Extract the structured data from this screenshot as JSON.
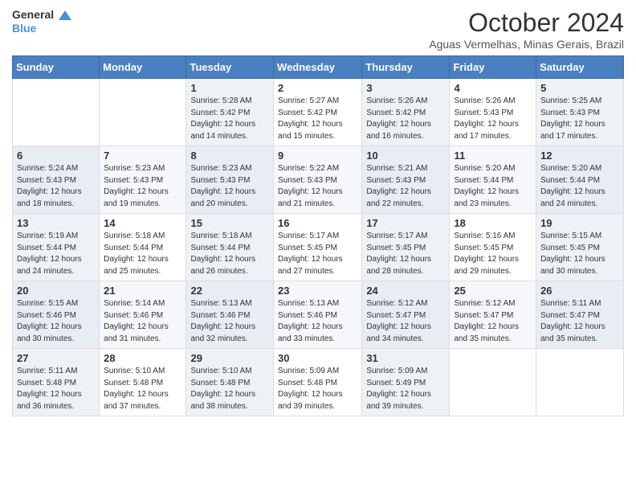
{
  "header": {
    "logo_line1": "General",
    "logo_line2": "Blue",
    "month_title": "October 2024",
    "location": "Aguas Vermelhas, Minas Gerais, Brazil"
  },
  "days_of_week": [
    "Sunday",
    "Monday",
    "Tuesday",
    "Wednesday",
    "Thursday",
    "Friday",
    "Saturday"
  ],
  "weeks": [
    [
      {
        "day": "",
        "info": ""
      },
      {
        "day": "",
        "info": ""
      },
      {
        "day": "1",
        "info": "Sunrise: 5:28 AM\nSunset: 5:42 PM\nDaylight: 12 hours and 14 minutes."
      },
      {
        "day": "2",
        "info": "Sunrise: 5:27 AM\nSunset: 5:42 PM\nDaylight: 12 hours and 15 minutes."
      },
      {
        "day": "3",
        "info": "Sunrise: 5:26 AM\nSunset: 5:42 PM\nDaylight: 12 hours and 16 minutes."
      },
      {
        "day": "4",
        "info": "Sunrise: 5:26 AM\nSunset: 5:43 PM\nDaylight: 12 hours and 17 minutes."
      },
      {
        "day": "5",
        "info": "Sunrise: 5:25 AM\nSunset: 5:43 PM\nDaylight: 12 hours and 17 minutes."
      }
    ],
    [
      {
        "day": "6",
        "info": "Sunrise: 5:24 AM\nSunset: 5:43 PM\nDaylight: 12 hours and 18 minutes."
      },
      {
        "day": "7",
        "info": "Sunrise: 5:23 AM\nSunset: 5:43 PM\nDaylight: 12 hours and 19 minutes."
      },
      {
        "day": "8",
        "info": "Sunrise: 5:23 AM\nSunset: 5:43 PM\nDaylight: 12 hours and 20 minutes."
      },
      {
        "day": "9",
        "info": "Sunrise: 5:22 AM\nSunset: 5:43 PM\nDaylight: 12 hours and 21 minutes."
      },
      {
        "day": "10",
        "info": "Sunrise: 5:21 AM\nSunset: 5:43 PM\nDaylight: 12 hours and 22 minutes."
      },
      {
        "day": "11",
        "info": "Sunrise: 5:20 AM\nSunset: 5:44 PM\nDaylight: 12 hours and 23 minutes."
      },
      {
        "day": "12",
        "info": "Sunrise: 5:20 AM\nSunset: 5:44 PM\nDaylight: 12 hours and 24 minutes."
      }
    ],
    [
      {
        "day": "13",
        "info": "Sunrise: 5:19 AM\nSunset: 5:44 PM\nDaylight: 12 hours and 24 minutes."
      },
      {
        "day": "14",
        "info": "Sunrise: 5:18 AM\nSunset: 5:44 PM\nDaylight: 12 hours and 25 minutes."
      },
      {
        "day": "15",
        "info": "Sunrise: 5:18 AM\nSunset: 5:44 PM\nDaylight: 12 hours and 26 minutes."
      },
      {
        "day": "16",
        "info": "Sunrise: 5:17 AM\nSunset: 5:45 PM\nDaylight: 12 hours and 27 minutes."
      },
      {
        "day": "17",
        "info": "Sunrise: 5:17 AM\nSunset: 5:45 PM\nDaylight: 12 hours and 28 minutes."
      },
      {
        "day": "18",
        "info": "Sunrise: 5:16 AM\nSunset: 5:45 PM\nDaylight: 12 hours and 29 minutes."
      },
      {
        "day": "19",
        "info": "Sunrise: 5:15 AM\nSunset: 5:45 PM\nDaylight: 12 hours and 30 minutes."
      }
    ],
    [
      {
        "day": "20",
        "info": "Sunrise: 5:15 AM\nSunset: 5:46 PM\nDaylight: 12 hours and 30 minutes."
      },
      {
        "day": "21",
        "info": "Sunrise: 5:14 AM\nSunset: 5:46 PM\nDaylight: 12 hours and 31 minutes."
      },
      {
        "day": "22",
        "info": "Sunrise: 5:13 AM\nSunset: 5:46 PM\nDaylight: 12 hours and 32 minutes."
      },
      {
        "day": "23",
        "info": "Sunrise: 5:13 AM\nSunset: 5:46 PM\nDaylight: 12 hours and 33 minutes."
      },
      {
        "day": "24",
        "info": "Sunrise: 5:12 AM\nSunset: 5:47 PM\nDaylight: 12 hours and 34 minutes."
      },
      {
        "day": "25",
        "info": "Sunrise: 5:12 AM\nSunset: 5:47 PM\nDaylight: 12 hours and 35 minutes."
      },
      {
        "day": "26",
        "info": "Sunrise: 5:11 AM\nSunset: 5:47 PM\nDaylight: 12 hours and 35 minutes."
      }
    ],
    [
      {
        "day": "27",
        "info": "Sunrise: 5:11 AM\nSunset: 5:48 PM\nDaylight: 12 hours and 36 minutes."
      },
      {
        "day": "28",
        "info": "Sunrise: 5:10 AM\nSunset: 5:48 PM\nDaylight: 12 hours and 37 minutes."
      },
      {
        "day": "29",
        "info": "Sunrise: 5:10 AM\nSunset: 5:48 PM\nDaylight: 12 hours and 38 minutes."
      },
      {
        "day": "30",
        "info": "Sunrise: 5:09 AM\nSunset: 5:48 PM\nDaylight: 12 hours and 39 minutes."
      },
      {
        "day": "31",
        "info": "Sunrise: 5:09 AM\nSunset: 5:49 PM\nDaylight: 12 hours and 39 minutes."
      },
      {
        "day": "",
        "info": ""
      },
      {
        "day": "",
        "info": ""
      }
    ]
  ]
}
